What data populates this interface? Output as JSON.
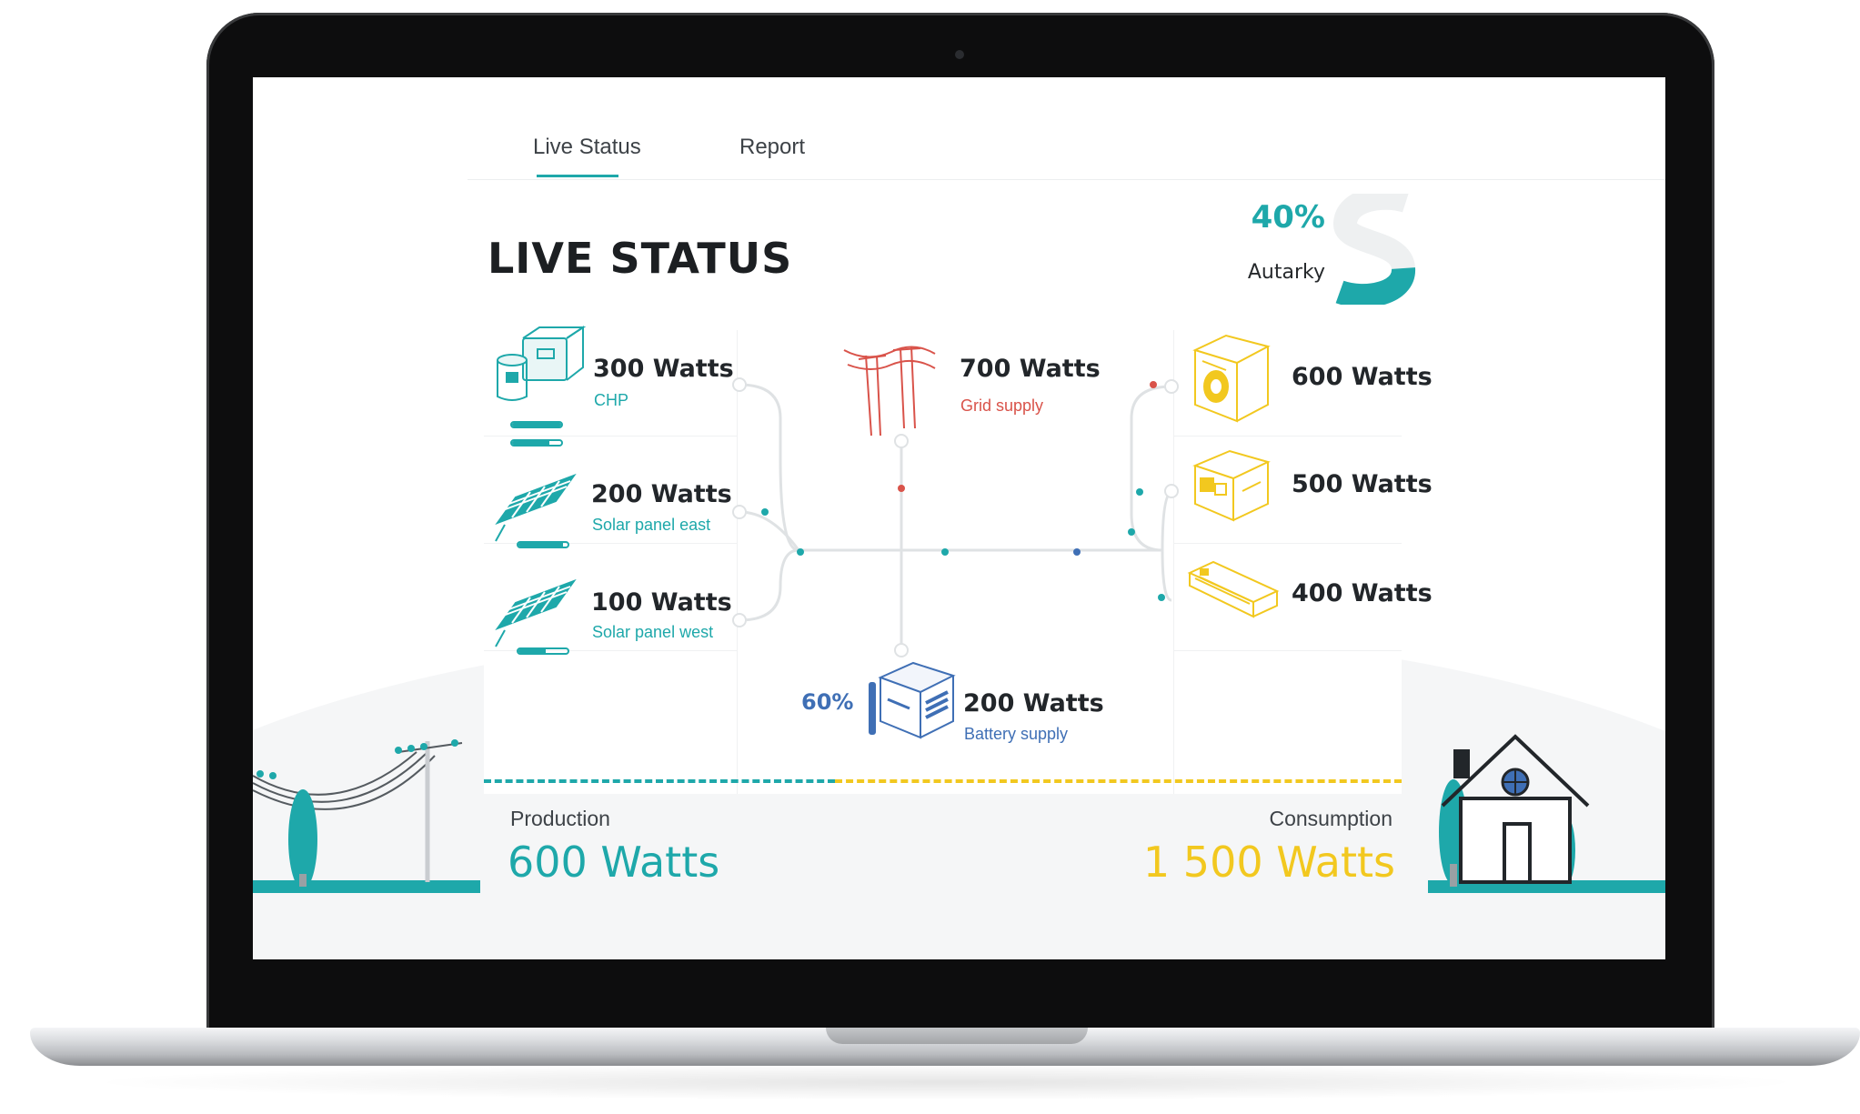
{
  "colors": {
    "accent": "#1ea8aa",
    "grid": "#d9534a",
    "battery": "#3f6fb5",
    "consumption": "#f2c81f"
  },
  "tabs": [
    {
      "label": "Live Status",
      "active": true
    },
    {
      "label": "Report",
      "active": false
    }
  ],
  "header": {
    "title": "LIVE STATUS",
    "autarky_pct": "40%",
    "autarky_label": "Autarky",
    "autarky_fraction": 0.4
  },
  "producers": [
    {
      "watts": "300 Watts",
      "label": "CHP",
      "icon": "chp-unit-icon"
    },
    {
      "watts": "200 Watts",
      "label": "Solar panel east",
      "icon": "solar-panel-icon"
    },
    {
      "watts": "100 Watts",
      "label": "Solar panel west",
      "icon": "solar-panel-icon"
    }
  ],
  "grid": {
    "watts": "700 Watts",
    "label": "Grid supply",
    "icon": "power-pole-icon"
  },
  "battery": {
    "watts": "200 Watts",
    "label": "Battery supply",
    "charge": "60%",
    "icon": "battery-icon"
  },
  "consumers": [
    {
      "watts": "600 Watts",
      "icon": "washing-machine-icon"
    },
    {
      "watts": "500 Watts",
      "icon": "oven-icon"
    },
    {
      "watts": "400 Watts",
      "icon": "air-conditioner-icon"
    }
  ],
  "production": {
    "label": "Production",
    "value": "600 Watts"
  },
  "consumption": {
    "label": "Consumption",
    "value": "1 500 Watts"
  }
}
